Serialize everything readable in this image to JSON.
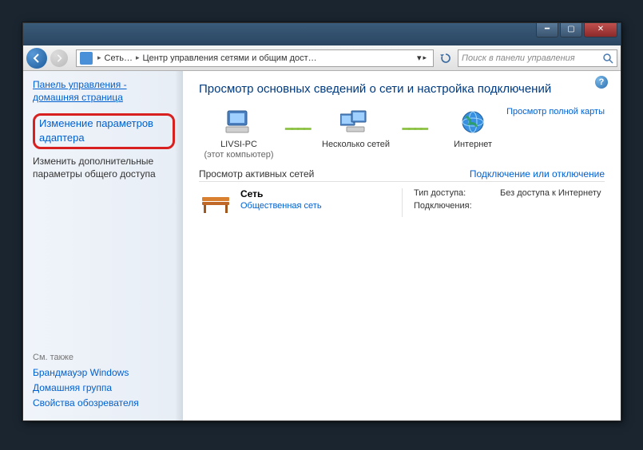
{
  "window": {
    "title": ""
  },
  "breadcrumb": {
    "seg1": "Сеть…",
    "seg2": "Центр управления сетями и общим дост…"
  },
  "search": {
    "placeholder": "Поиск в панели управления"
  },
  "sidebar": {
    "home": "Панель управления - домашняя страница",
    "adapter": "Изменение параметров адаптера",
    "advanced": "Изменить дополнительные параметры общего доступа",
    "also_label": "См. также",
    "firewall": "Брандмауэр Windows",
    "homegroup": "Домашняя группа",
    "ie_options": "Свойства обозревателя"
  },
  "main": {
    "heading": "Просмотр основных сведений о сети и настройка подключений",
    "full_map": "Просмотр полной карты",
    "map": {
      "pc_name": "LIVSI-PC",
      "pc_sub": "(этот компьютер)",
      "multi": "Несколько сетей",
      "internet": "Интернет"
    },
    "active_title": "Просмотр активных сетей",
    "active_right": "Подключение или отключение",
    "net": {
      "name": "Сеть",
      "type": "Общественная сеть",
      "access_k": "Тип доступа:",
      "access_v": "Без доступа к Интернету",
      "conn_k": "Подключения:"
    }
  }
}
